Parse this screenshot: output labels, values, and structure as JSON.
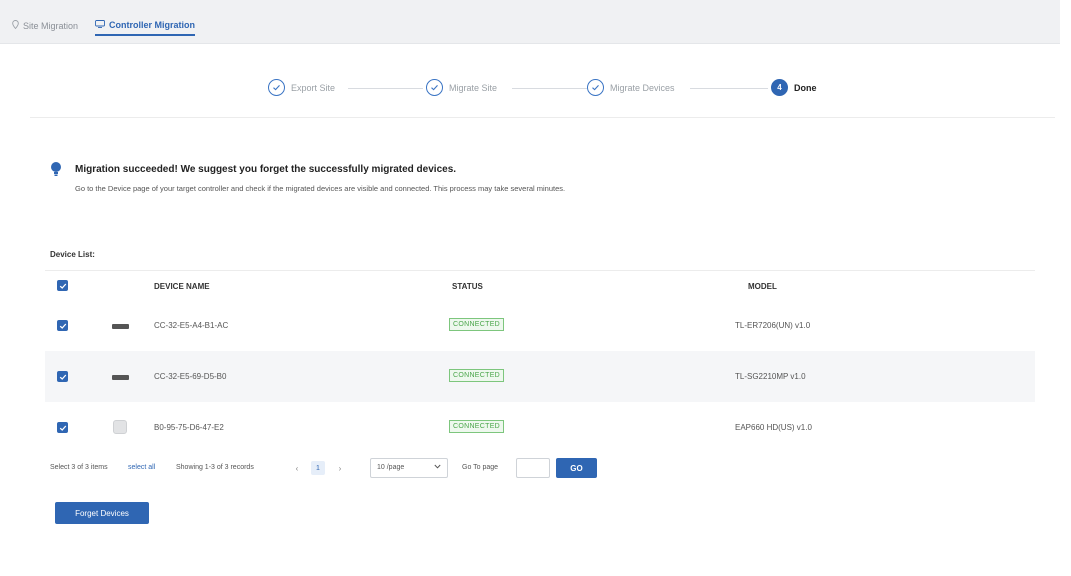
{
  "tabs": {
    "site_migration": "Site Migration",
    "controller_migration": "Controller Migration"
  },
  "stepper": {
    "steps": [
      {
        "label": "Export Site",
        "state": "done"
      },
      {
        "label": "Migrate Site",
        "state": "done"
      },
      {
        "label": "Migrate Devices",
        "state": "done"
      },
      {
        "label": "Done",
        "number": "4",
        "state": "current"
      }
    ]
  },
  "message": {
    "title": "Migration succeeded! We suggest you forget the successfully migrated devices.",
    "body": "Go to the Device page of your target controller and check if the migrated devices are visible and connected. This process may take several minutes."
  },
  "device_list": {
    "label": "Device List:",
    "headers": {
      "device_name": "DEVICE NAME",
      "status": "STATUS",
      "model": "MODEL"
    },
    "rows": [
      {
        "name": "CC-32-E5-A4-B1-AC",
        "status": "CONNECTED",
        "model": "TL-ER7206(UN) v1.0",
        "icon": "router-icon",
        "checked": true
      },
      {
        "name": "CC-32-E5-69-D5-B0",
        "status": "CONNECTED",
        "model": "TL-SG2210MP v1.0",
        "icon": "switch-icon",
        "checked": true
      },
      {
        "name": "B0-95-75-D6-47-E2",
        "status": "CONNECTED",
        "model": "EAP660 HD(US) v1.0",
        "icon": "access-point-icon",
        "checked": true
      }
    ]
  },
  "pagination": {
    "selected_text": "Select 3 of 3 items",
    "select_all": "select all",
    "showing": "Showing 1-3 of 3 records",
    "prev": "‹",
    "current_page": "1",
    "next": "›",
    "page_size": "10 /page",
    "goto_label": "Go To page",
    "goto_value": "",
    "go_button": "GO"
  },
  "actions": {
    "forget_button": "Forget Devices"
  },
  "colors": {
    "accent": "#2f66b3",
    "connected": "#4aa64a"
  }
}
